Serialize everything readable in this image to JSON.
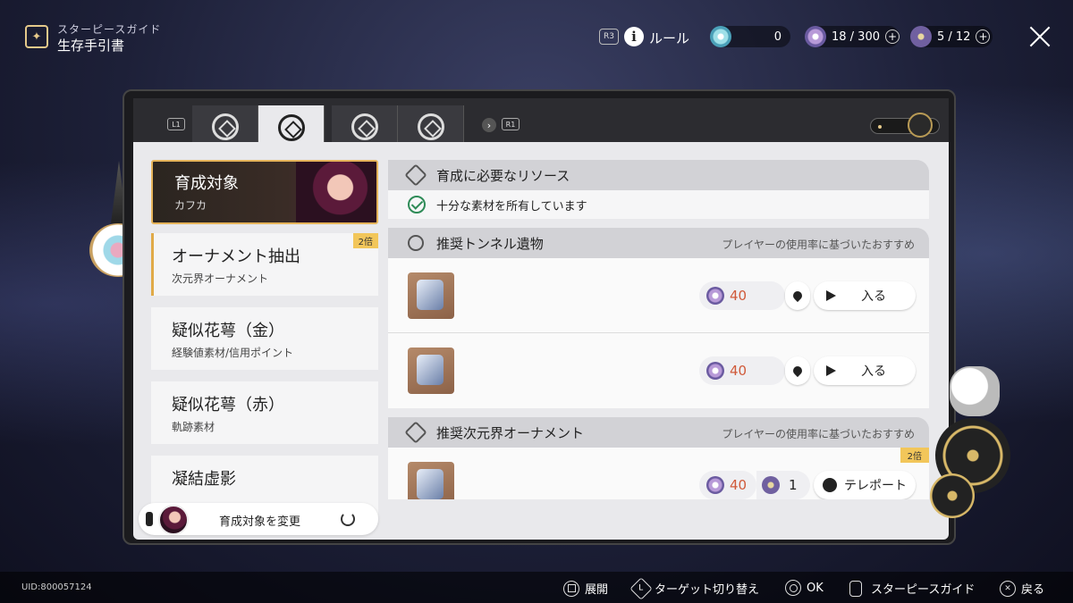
{
  "header": {
    "guide_sub": "スターピースガイド",
    "guide_title": "生存手引書",
    "r3_label": "R3",
    "rule_label": "ルール",
    "currency1_value": "0",
    "currency2_value": "18 / 300",
    "currency3_value": "5 / 12",
    "plus": "+"
  },
  "tabs": {
    "l1": "L1",
    "r1": "R1",
    "next": "›"
  },
  "left": {
    "cards": [
      {
        "title": "育成対象",
        "sub": "カフカ"
      },
      {
        "title": "オーナメント抽出",
        "sub": "次元界オーナメント",
        "badge": "2倍"
      },
      {
        "title": "疑似花萼（金）",
        "sub": "経験値素材/信用ポイント"
      },
      {
        "title": "疑似花萼（赤）",
        "sub": "軌跡素材"
      },
      {
        "title": "凝結虚影",
        "sub": ""
      }
    ],
    "change_label": "育成対象を変更"
  },
  "right": {
    "resources_title": "育成に必要なリソース",
    "resources_ok": "十分な素材を所有しています",
    "tunnel_title": "推奨トンネル遺物",
    "tunnel_note": "プレイヤーの使用率に基づいたおすすめ",
    "ornament_title": "推奨次元界オーナメント",
    "ornament_note": "プレイヤーの使用率に基づいたおすすめ",
    "rows": [
      {
        "cost": "40",
        "action": "入る"
      },
      {
        "cost": "40",
        "action": "入る"
      },
      {
        "cost": "40",
        "extra": "1",
        "action": "テレポート",
        "badge": "2倍"
      }
    ]
  },
  "footer": {
    "uid": "UID:800057124",
    "expand": "展開",
    "target_switch": "ターゲット切り替え",
    "ok": "OK",
    "star_guide": "スターピースガイド",
    "back": "戻る",
    "l_label": "L"
  }
}
